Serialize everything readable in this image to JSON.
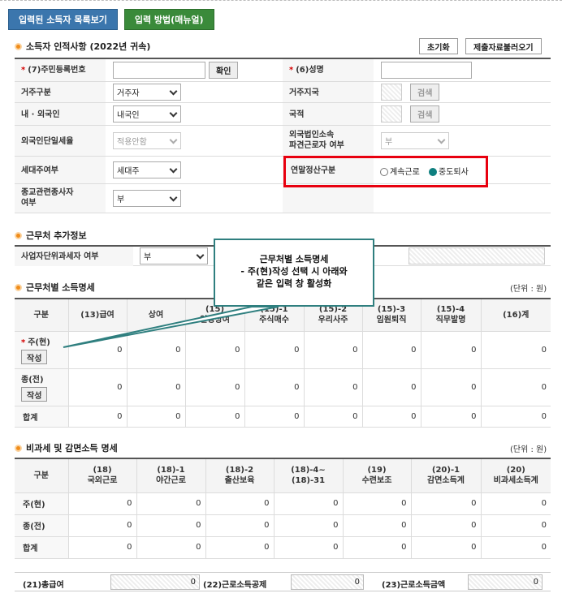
{
  "top_buttons": {
    "registered_list": "입력된 소득자 목록보기",
    "manual": "입력 방법(매뉴얼)"
  },
  "section_person": {
    "title": "소득자 인적사항 (2022년 귀속)",
    "reset": "초기화",
    "load": "제출자료불러오기",
    "labels": {
      "rrn": "(7)주민등록번호",
      "name": "(6)성명",
      "residence_type": "거주구분",
      "residence_country": "거주지국",
      "domestic_foreign": "내 · 외국인",
      "nationality": "국적",
      "foreign_flat": "외국인단일세율",
      "dispatched_1": "외국법인소속",
      "dispatched_2": "파견근로자 여부",
      "householder": "세대주여부",
      "settlement": "연말정산구분",
      "religious_1": "종교관련종사자",
      "religious_2": "여부"
    },
    "confirm": "확인",
    "search": "검색",
    "values": {
      "residence_type": "거주자",
      "domestic_foreign": "내국인",
      "foreign_flat": "적용안함",
      "dispatched": "부",
      "householder": "세대주",
      "religious": "부"
    },
    "settlement_options": [
      "계속근로",
      "중도퇴사"
    ]
  },
  "section_work": {
    "title": "근무처 추가정보",
    "label": "사업자단위과세자 여부",
    "value": "부"
  },
  "callout": {
    "line1": "근무처별 소득명세",
    "line2": "- 주(현)작성 선택 시 아래와",
    "line3": "같은 입력 창 활성화"
  },
  "section_income": {
    "title": "근무처별 소득명세",
    "unit": "(단위 : 원)",
    "headers": [
      {
        "l1": "",
        "l2": "구분"
      },
      {
        "l1": "",
        "l2": "(13)급여"
      },
      {
        "l1": "",
        "l2": "상여"
      },
      {
        "l1": "(15)",
        "l2": "인정상여"
      },
      {
        "l1": "(15)-1",
        "l2": "주식매수"
      },
      {
        "l1": "(15)-2",
        "l2": "우리사주"
      },
      {
        "l1": "(15)-3",
        "l2": "임원퇴직"
      },
      {
        "l1": "(15)-4",
        "l2": "직무발명"
      },
      {
        "l1": "",
        "l2": "(16)계"
      }
    ],
    "rows": [
      {
        "label": "주(현)",
        "btn": "작성",
        "values": [
          "0",
          "0",
          "0",
          "0",
          "0",
          "0",
          "0",
          "0"
        ]
      },
      {
        "label": "종(전)",
        "btn": "작성",
        "values": [
          "0",
          "0",
          "0",
          "0",
          "0",
          "0",
          "0",
          "0"
        ]
      },
      {
        "label": "합계",
        "values": [
          "0",
          "0",
          "0",
          "0",
          "0",
          "0",
          "0",
          "0"
        ]
      }
    ]
  },
  "section_taxfree": {
    "title": "비과세 및 감면소득 명세",
    "unit": "(단위 : 원)",
    "headers": [
      {
        "l1": "",
        "l2": "구분"
      },
      {
        "l1": "(18)",
        "l2": "국외근로"
      },
      {
        "l1": "(18)-1",
        "l2": "야간근로"
      },
      {
        "l1": "(18)-2",
        "l2": "출산보육"
      },
      {
        "l1": "(18)-4~",
        "l2": "(18)-31"
      },
      {
        "l1": "(19)",
        "l2": "수련보조"
      },
      {
        "l1": "(20)-1",
        "l2": "감면소득계"
      },
      {
        "l1": "(20)",
        "l2": "비과세소득계"
      }
    ],
    "rows": [
      {
        "label": "주(현)",
        "values": [
          "0",
          "0",
          "0",
          "0",
          "0",
          "0",
          "0"
        ]
      },
      {
        "label": "종(전)",
        "values": [
          "0",
          "0",
          "0",
          "0",
          "0",
          "0",
          "0"
        ]
      },
      {
        "label": "합계",
        "values": [
          "0",
          "0",
          "0",
          "0",
          "0",
          "0",
          "0"
        ]
      }
    ]
  },
  "totals": [
    {
      "label": "(21)총급여",
      "value": "0"
    },
    {
      "label": "(22)근로소득공제",
      "value": "0"
    },
    {
      "label": "(23)근로소득금액",
      "value": "0"
    }
  ]
}
